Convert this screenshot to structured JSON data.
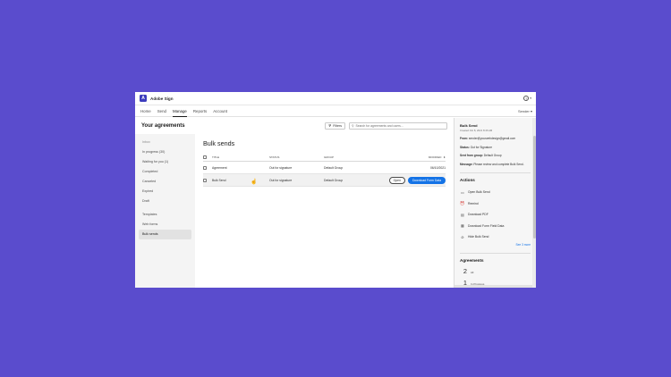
{
  "app": {
    "title": "Adobe Sign",
    "logo": "A"
  },
  "nav": {
    "items": [
      "Home",
      "Send",
      "Manage",
      "Reports",
      "Account"
    ],
    "active": "Manage",
    "sender_label": "Sender"
  },
  "toolbar": {
    "heading": "Your agreements",
    "filters_label": "Filters",
    "search_placeholder": "Search for agreements and users..."
  },
  "sidebar": {
    "section_label": "Inbox",
    "items": [
      "In progress (30)",
      "Waiting for you (1)",
      "Completed",
      "Canceled",
      "Expired",
      "Draft"
    ],
    "items2": [
      "Templates",
      "Web forms",
      "Bulk sends"
    ],
    "active": "Bulk sends"
  },
  "table": {
    "heading": "Bulk sends",
    "headers": {
      "title": "TITLE",
      "status": "STATUS",
      "group": "GROUP",
      "modified": "MODIFIED"
    },
    "rows": [
      {
        "title": "Agreement",
        "status": "Out for signature",
        "group": "Default Group",
        "modified": "06/10/2021"
      },
      {
        "title": "Bulk Send",
        "status": "Out for signature",
        "group": "Default Group",
        "open_label": "Open",
        "download_label": "Download Form Data"
      }
    ]
  },
  "rail": {
    "title": "Bulk Send",
    "created": "Created Oct 8, 2021 8:46 AM",
    "from_label": "From:",
    "from_value": "sender@yourwebdesign@gmail.com",
    "status_label": "Status:",
    "status_value": "Out for Signature",
    "sent_label": "Sent from group:",
    "sent_value": "Default Group",
    "message_label": "Message:",
    "message_value": "Please review and complete Bulk Send.",
    "actions_heading": "Actions",
    "actions": [
      {
        "icon": "document-icon",
        "label": "Open Bulk Send"
      },
      {
        "icon": "reminder-icon",
        "label": "Remind"
      },
      {
        "icon": "pdf-icon",
        "label": "Download PDF"
      },
      {
        "icon": "form-data-icon",
        "label": "Download Form Field Data"
      },
      {
        "icon": "hide-icon",
        "label": "Hide Bulk Send"
      }
    ],
    "see_more": "See 3 more",
    "agreements_heading": "Agreements",
    "agreements": [
      {
        "count": "2",
        "label": "All"
      },
      {
        "count": "1",
        "label": "In Progress"
      }
    ]
  },
  "colors": {
    "background": "#5a4ccd",
    "accent": "#1473e6"
  }
}
